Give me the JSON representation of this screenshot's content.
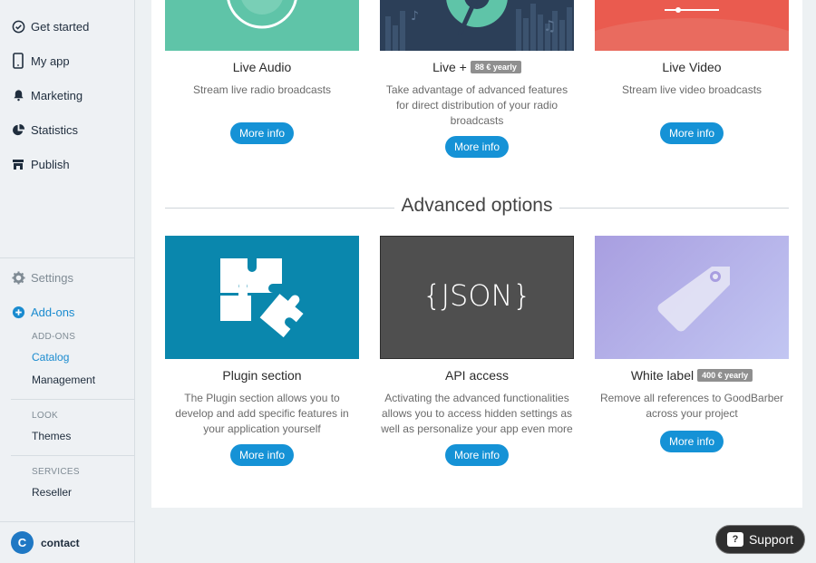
{
  "sidebar": {
    "items": [
      {
        "label": "Get started",
        "icon": "check-circle-icon"
      },
      {
        "label": "My app",
        "icon": "phone-icon"
      },
      {
        "label": "Marketing",
        "icon": "bell-icon"
      },
      {
        "label": "Statistics",
        "icon": "pie-chart-icon"
      },
      {
        "label": "Publish",
        "icon": "store-icon"
      }
    ],
    "settings": "Settings",
    "addons": "Add-ons",
    "groups": {
      "addons_label": "ADD-ONS",
      "catalog": "Catalog",
      "management": "Management",
      "look_label": "LOOK",
      "themes": "Themes",
      "services_label": "SERVICES",
      "reseller": "Reseller"
    },
    "contact": "contact",
    "contact_avatar": "C"
  },
  "top_tiles": [
    {
      "title": "Live Audio",
      "desc": "Stream live radio broadcasts",
      "button": "More info"
    },
    {
      "title": "Live +",
      "badge": "88 € yearly",
      "desc": "Take advantage of advanced features for direct distribution of your radio broadcasts",
      "button": "More info"
    },
    {
      "title": "Live Video",
      "desc": "Stream live video broadcasts",
      "button": "More info"
    }
  ],
  "section_title": "Advanced options",
  "bottom_tiles": [
    {
      "title": "Plugin section",
      "desc": "The Plugin section allows you to develop and add specific features in your application yourself",
      "button": "More info"
    },
    {
      "title": "API access",
      "image_text": "{JSON}",
      "desc": "Activating the advanced functionalities allows you to access hidden settings as well as personalize your app even more",
      "button": "More info"
    },
    {
      "title": "White label",
      "badge": "400 € yearly",
      "desc": "Remove all references to GoodBarber across your project",
      "button": "More info"
    }
  ],
  "support": {
    "label": "Support",
    "icon_glyph": "?"
  },
  "colors": {
    "accent": "#1592d6",
    "teal": "#5fc4a8",
    "navy": "#2c3f58",
    "coral": "#ea5b4f",
    "plugin": "#0a87ad",
    "api": "#4f4f4f"
  }
}
